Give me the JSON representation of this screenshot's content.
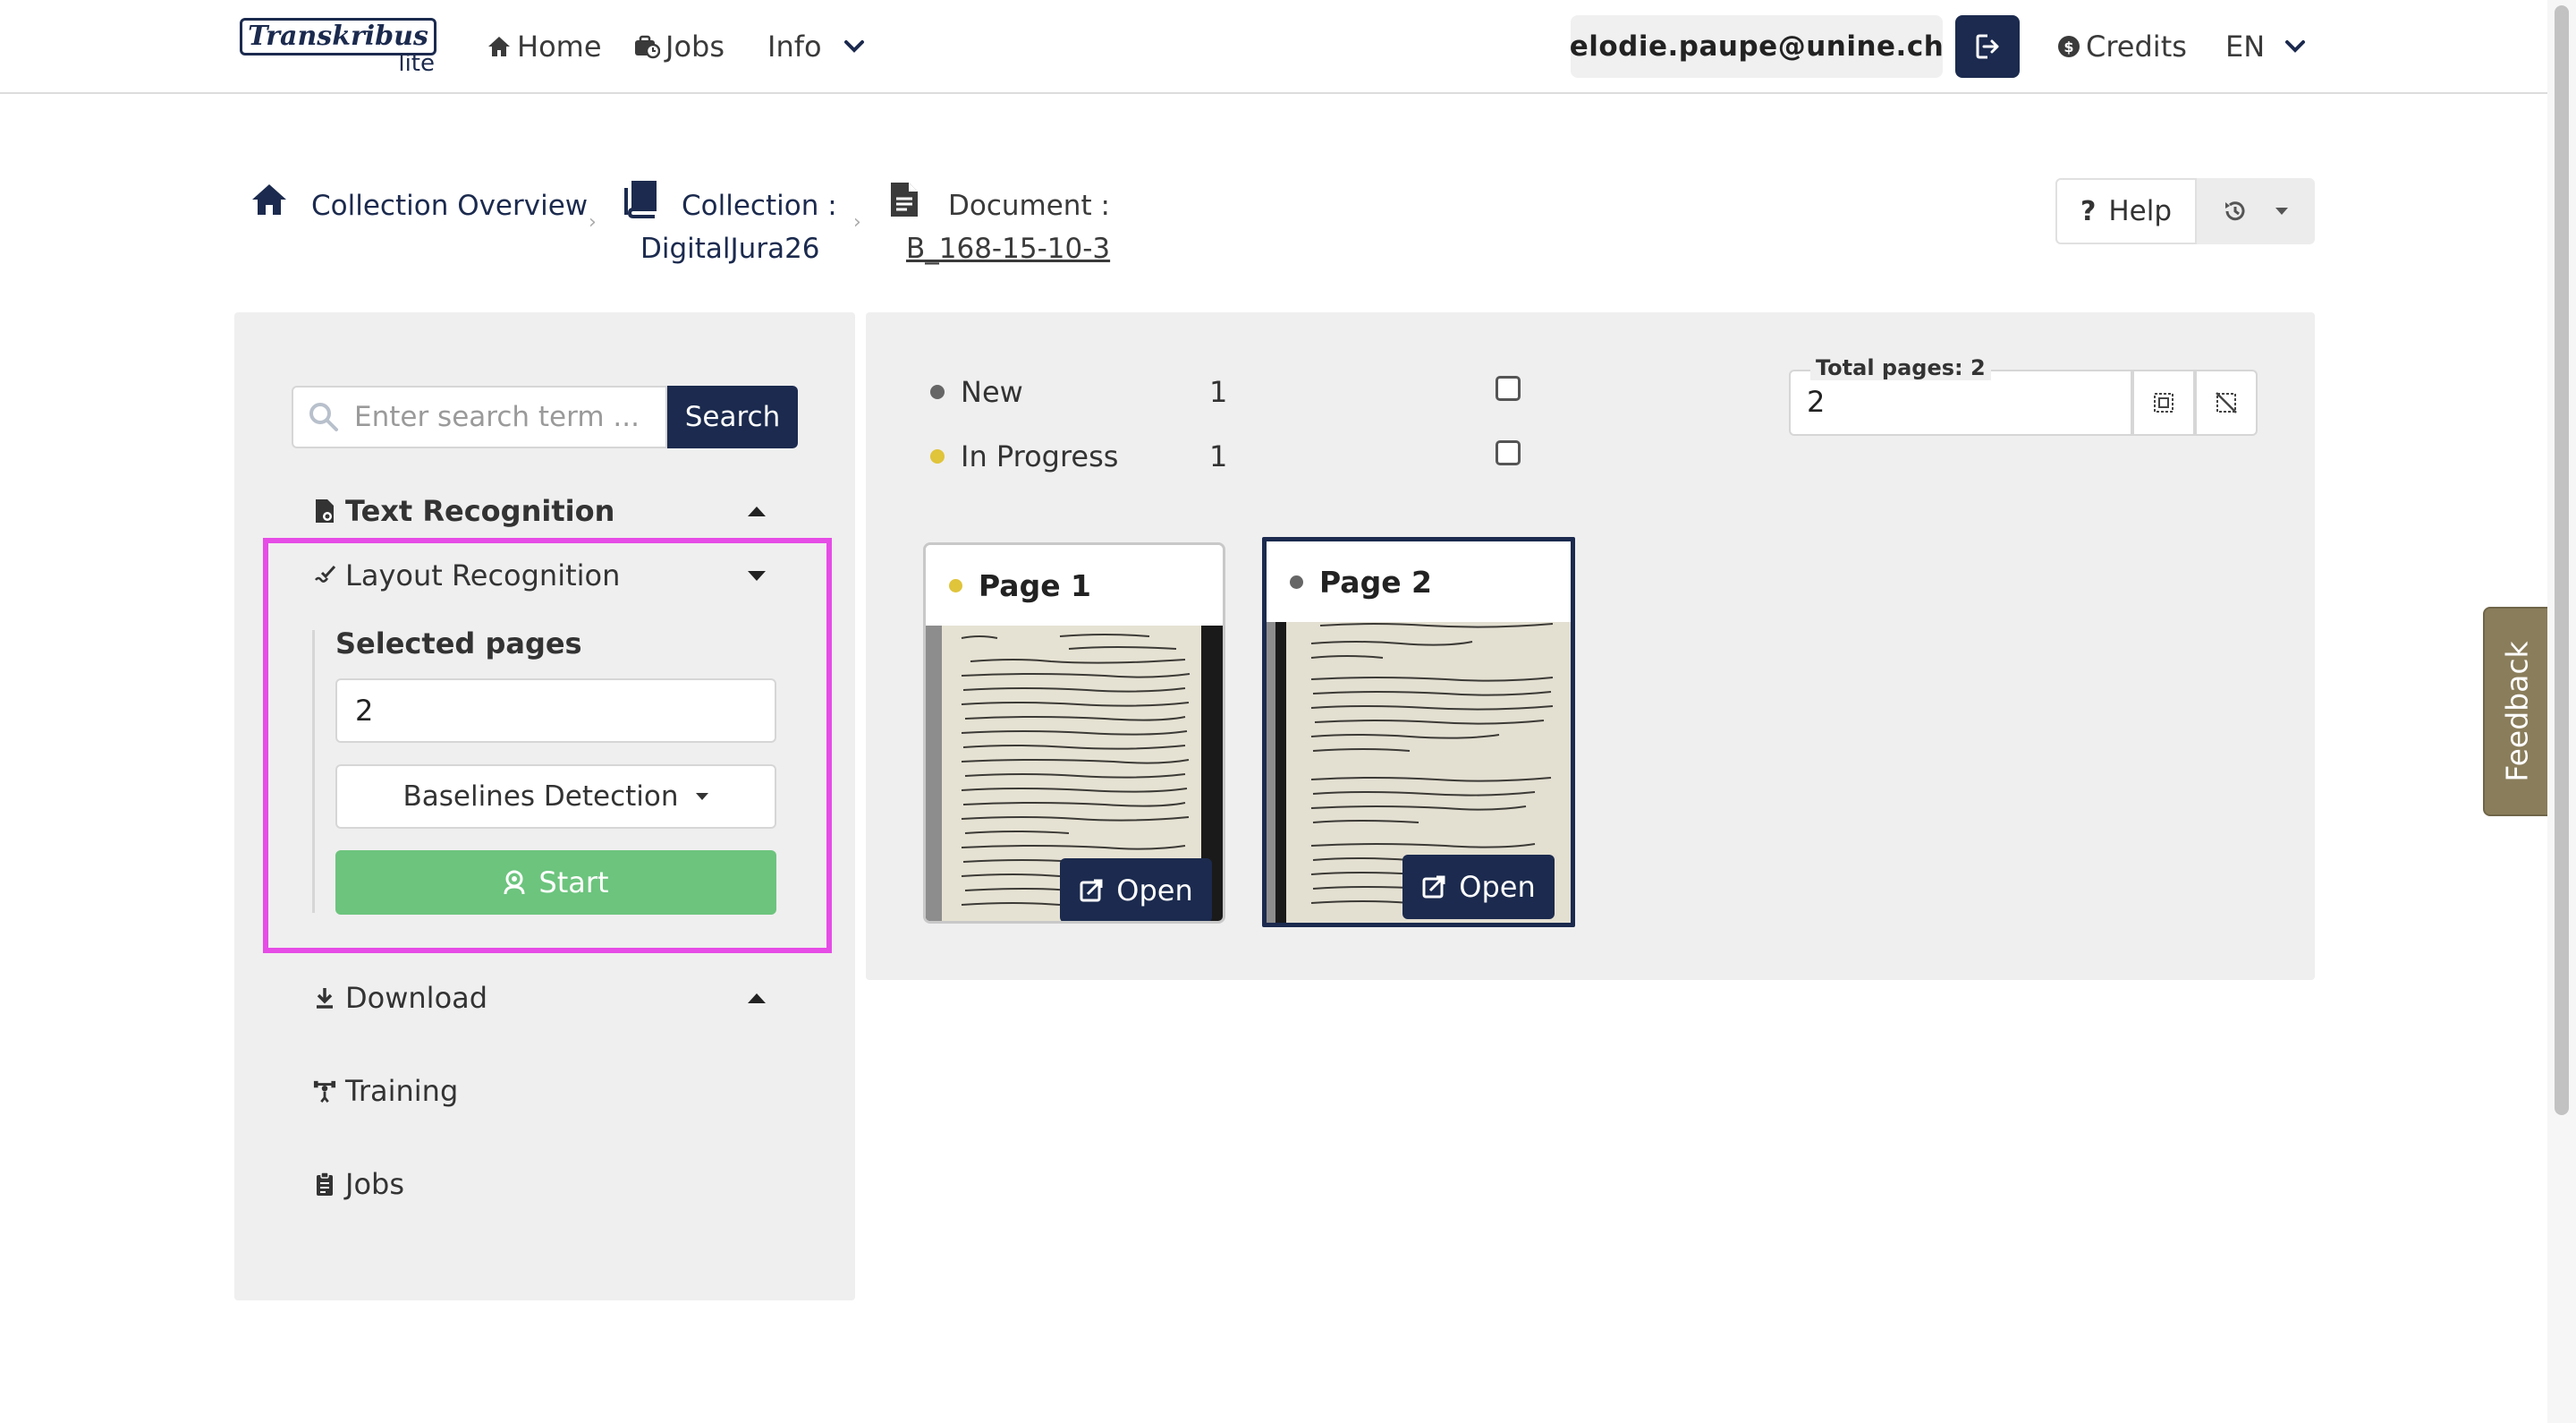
{
  "navbar": {
    "logo_main": "Transkribus",
    "logo_sub": "lite",
    "home": "Home",
    "jobs": "Jobs",
    "info": "Info",
    "email": "elodie.paupe@unine.ch",
    "credits": "Credits",
    "language": "EN"
  },
  "breadcrumb": {
    "overview": "Collection Overview",
    "collection_label": "Collection :",
    "collection_name": "DigitalJura26",
    "document_label": "Document :",
    "document_name": "B_168-15-10-3",
    "help": "Help"
  },
  "sidebar": {
    "search_placeholder": "Enter search term ...",
    "search_button": "Search",
    "text_recognition": "Text Recognition",
    "layout_recognition": "Layout Recognition",
    "selected_pages_label": "Selected pages",
    "selected_pages_value": "2",
    "model_dropdown": "Baselines Detection",
    "start_button": "Start",
    "download": "Download",
    "training": "Training",
    "jobs": "Jobs"
  },
  "status_filters": [
    {
      "label": "New",
      "count": "1",
      "color": "#666666"
    },
    {
      "label": "In Progress",
      "count": "1",
      "color": "#e0c43a"
    }
  ],
  "pages": {
    "total_label": "Total pages: 2",
    "selection_value": "2",
    "cards": [
      {
        "title": "Page 1",
        "status_color": "#e0c43a",
        "open": "Open",
        "selected": false
      },
      {
        "title": "Page 2",
        "status_color": "#666666",
        "open": "Open",
        "selected": true
      }
    ]
  },
  "feedback": "Feedback"
}
